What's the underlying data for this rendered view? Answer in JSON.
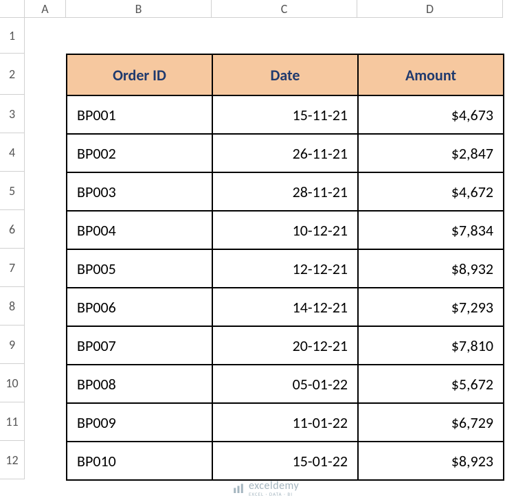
{
  "columns": [
    "A",
    "B",
    "C",
    "D"
  ],
  "row_numbers": [
    "1",
    "2",
    "3",
    "4",
    "5",
    "6",
    "7",
    "8",
    "9",
    "10",
    "11",
    "12"
  ],
  "headers": {
    "order_id": "Order ID",
    "date": "Date",
    "amount": "Amount"
  },
  "rows": [
    {
      "order_id": "BP001",
      "date": "15-11-21",
      "amount": "$4,673"
    },
    {
      "order_id": "BP002",
      "date": "26-11-21",
      "amount": "$2,847"
    },
    {
      "order_id": "BP003",
      "date": "28-11-21",
      "amount": "$4,672"
    },
    {
      "order_id": "BP004",
      "date": "10-12-21",
      "amount": "$7,834"
    },
    {
      "order_id": "BP005",
      "date": "12-12-21",
      "amount": "$8,932"
    },
    {
      "order_id": "BP006",
      "date": "14-12-21",
      "amount": "$7,293"
    },
    {
      "order_id": "BP007",
      "date": "20-12-21",
      "amount": "$7,810"
    },
    {
      "order_id": "BP008",
      "date": "05-01-22",
      "amount": "$5,672"
    },
    {
      "order_id": "BP009",
      "date": "11-01-22",
      "amount": "$6,729"
    },
    {
      "order_id": "BP010",
      "date": "15-01-22",
      "amount": "$8,923"
    }
  ],
  "watermark": {
    "main": "exceldemy",
    "sub": "EXCEL · DATA · BI"
  },
  "chart_data": {
    "type": "table",
    "title": "",
    "columns": [
      "Order ID",
      "Date",
      "Amount"
    ],
    "data": [
      [
        "BP001",
        "15-11-21",
        4673
      ],
      [
        "BP002",
        "26-11-21",
        2847
      ],
      [
        "BP003",
        "28-11-21",
        4672
      ],
      [
        "BP004",
        "10-12-21",
        7834
      ],
      [
        "BP005",
        "12-12-21",
        8932
      ],
      [
        "BP006",
        "14-12-21",
        7293
      ],
      [
        "BP007",
        "20-12-21",
        7810
      ],
      [
        "BP008",
        "05-01-22",
        5672
      ],
      [
        "BP009",
        "11-01-22",
        6729
      ],
      [
        "BP010",
        "15-01-22",
        8923
      ]
    ]
  }
}
